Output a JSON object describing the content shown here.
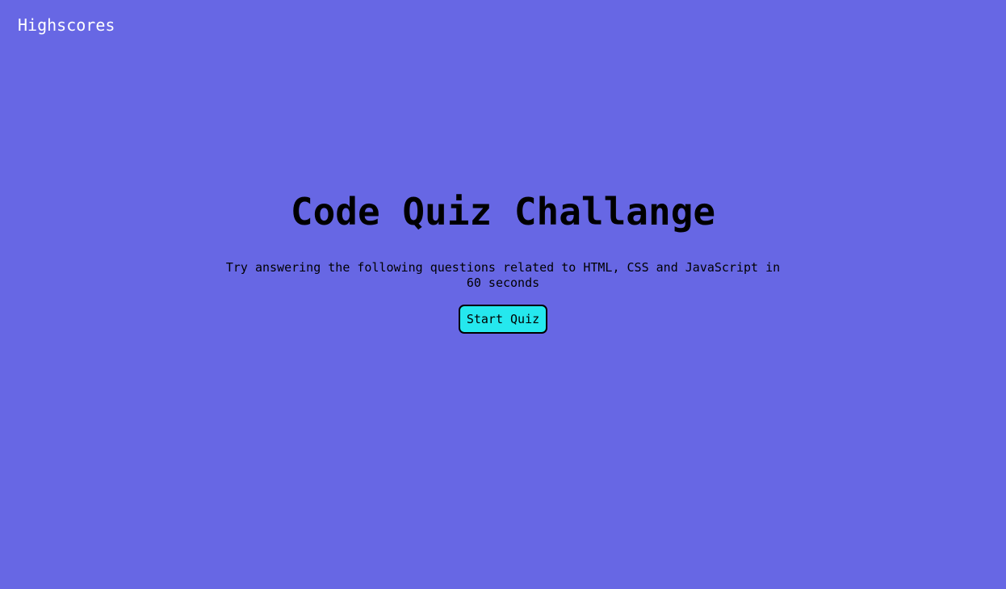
{
  "header": {
    "highscores_label": "Highscores"
  },
  "intro": {
    "title": "Code Quiz Challange",
    "description": "Try answering the following questions related to HTML, CSS and JavaScript in 60 seconds",
    "start_button_label": "Start Quiz"
  },
  "colors": {
    "background": "#6767e4",
    "button": "#25e8ee",
    "link_text": "#ffffff",
    "text": "#000000"
  }
}
